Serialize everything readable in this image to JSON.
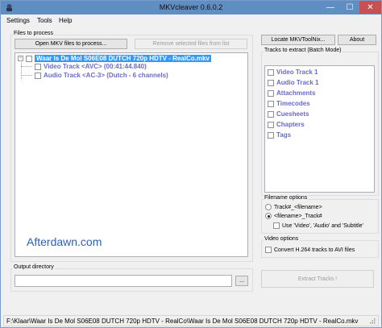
{
  "window": {
    "title": "MKVcleaver 0.6.0.2",
    "controls": {
      "minimize": "—",
      "maximize": "☐",
      "close": "✕"
    }
  },
  "menu": {
    "items": [
      "Settings",
      "Tools",
      "Help"
    ]
  },
  "files_group": {
    "title": "Files to process",
    "open_button": "Open MKV files to process...",
    "remove_button": "Remove selected files from list",
    "tree": {
      "file": "Waar Is De Mol S06E08 DUTCH 720p HDTV - RealCo.mkv",
      "expander": "−",
      "tracks": [
        "Video Track <AVC> (00:41:44.840)",
        "Audio Track <AC-3> (Dutch - 6 channels)"
      ]
    },
    "watermark": "Afterdawn.com"
  },
  "right_panel": {
    "locate_button": "Locate MKVToolNix...",
    "about_button": "About",
    "extract_group_title": "Tracks to extract (Batch Mode)",
    "tracks": [
      "Video Track 1",
      "Audio Track 1",
      "Attachments",
      "Timecodes",
      "Cuesheets",
      "Chapters",
      "Tags"
    ],
    "filename_group_title": "Filename options",
    "filename_options": [
      "Track#_<filename>",
      "<filename>_Track#"
    ],
    "filename_selected": 1,
    "use_names_label": "Use 'Video', 'Audio' and 'Subtitle'",
    "video_group_title": "Video options",
    "convert_label": "Convert H.264 tracks to AVI files",
    "extract_button": "Extract Tracks !"
  },
  "output": {
    "title": "Output directory",
    "value": "",
    "browse_button": "..."
  },
  "status": {
    "text": "F:\\Klaar\\Waar Is De Mol S06E08 DUTCH 720p HDTV - RealCo\\Waar Is De Mol S06E08 DUTCH 720p HDTV - RealCo.mkv"
  },
  "colors": {
    "title_bar": "#5f8ec2",
    "close_button": "#c75050",
    "track_text": "#6a6acd",
    "selection": "#3399ff",
    "watermark": "#2d5fb7"
  }
}
